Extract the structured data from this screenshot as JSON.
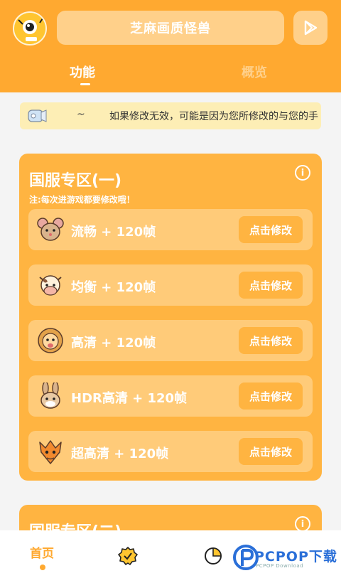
{
  "header": {
    "title": "芝麻画质怪兽",
    "tabs": [
      {
        "label": "功能",
        "active": true
      },
      {
        "label": "概览",
        "active": false
      }
    ]
  },
  "notice": {
    "prefix": "~",
    "text": "如果修改无效，可能是因为您所修改的与您的手"
  },
  "cards": [
    {
      "title": "国服专区(一)",
      "subtitle": "注:每次进游戏都要修改哦！",
      "rows": [
        {
          "label": "流畅 + 120帧",
          "button": "点击修改",
          "icon": "mouse-icon"
        },
        {
          "label": "均衡 + 120帧",
          "button": "点击修改",
          "icon": "cow-icon"
        },
        {
          "label": "高清 + 120帧",
          "button": "点击修改",
          "icon": "lion-icon"
        },
        {
          "label": "HDR高清 + 120帧",
          "button": "点击修改",
          "icon": "rabbit-icon"
        },
        {
          "label": "超高清 + 120帧",
          "button": "点击修改",
          "icon": "dragon-icon"
        }
      ]
    },
    {
      "title": "国服专区(二)"
    }
  ],
  "bottom_nav": {
    "home_label": "首页"
  },
  "watermark": {
    "text": "PCPOP下载",
    "sub": "PCPOP Download"
  },
  "colors": {
    "accent": "#ffa930",
    "card": "#ffb441",
    "row": "#ffcb79",
    "notice_bg": "#fdeeb5"
  }
}
